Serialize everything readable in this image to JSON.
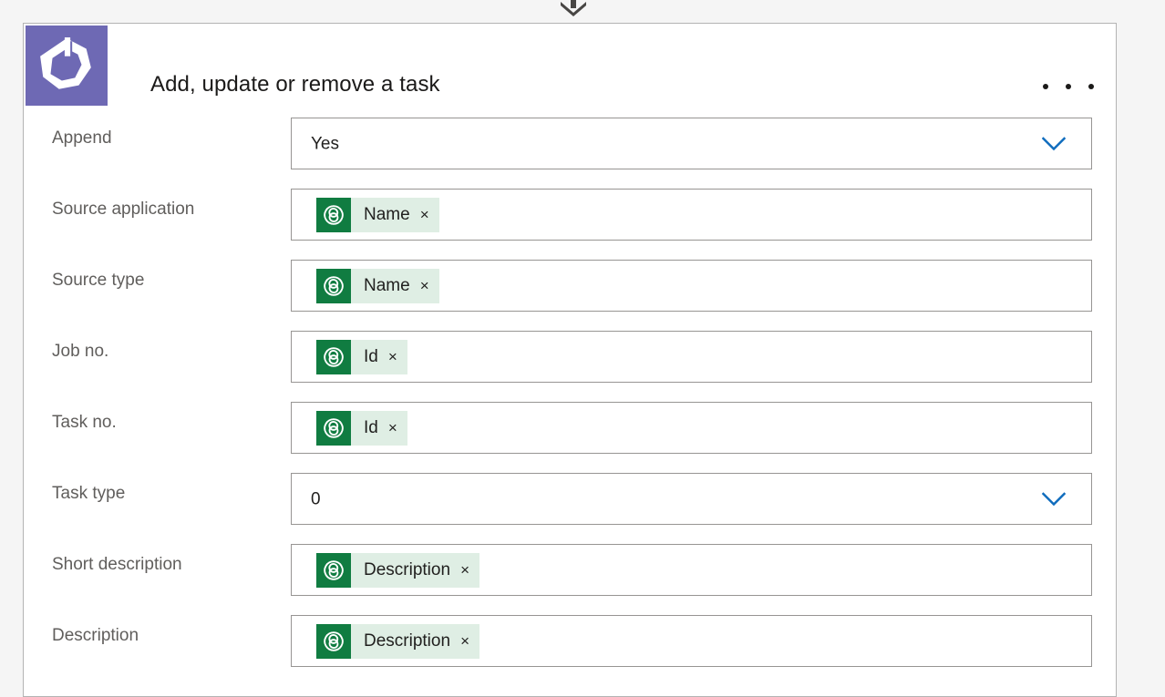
{
  "connector": {
    "arrow_icon": "arrow-down-icon"
  },
  "card": {
    "logo_icon": "dynamics-business-central-logo",
    "title": "Add, update or remove a task",
    "overflow_label": "...",
    "accent_purple": "#6e69b4",
    "token_icon_green": "#107c41",
    "token_background_green": "#dfeee4",
    "chevron_blue": "#0f6cbd"
  },
  "fields": [
    {
      "label": "Append",
      "type": "dropdown",
      "value": "Yes",
      "chevron_icon": "chevron-down-icon"
    },
    {
      "label": "Source application",
      "type": "token",
      "token_text": "Name",
      "token_icon": "dynamic-content-icon",
      "remove_icon": "×"
    },
    {
      "label": "Source type",
      "type": "token",
      "token_text": "Name",
      "token_icon": "dynamic-content-icon",
      "remove_icon": "×"
    },
    {
      "label": "Job no.",
      "type": "token",
      "token_text": "Id",
      "token_icon": "dynamic-content-icon",
      "remove_icon": "×"
    },
    {
      "label": "Task no.",
      "type": "token",
      "token_text": "Id",
      "token_icon": "dynamic-content-icon",
      "remove_icon": "×"
    },
    {
      "label": "Task type",
      "type": "dropdown",
      "value": "0",
      "chevron_icon": "chevron-down-icon"
    },
    {
      "label": "Short description",
      "type": "token",
      "token_text": "Description",
      "token_icon": "dynamic-content-icon",
      "remove_icon": "×"
    },
    {
      "label": "Description",
      "type": "token",
      "token_text": "Description",
      "token_icon": "dynamic-content-icon",
      "remove_icon": "×"
    }
  ]
}
